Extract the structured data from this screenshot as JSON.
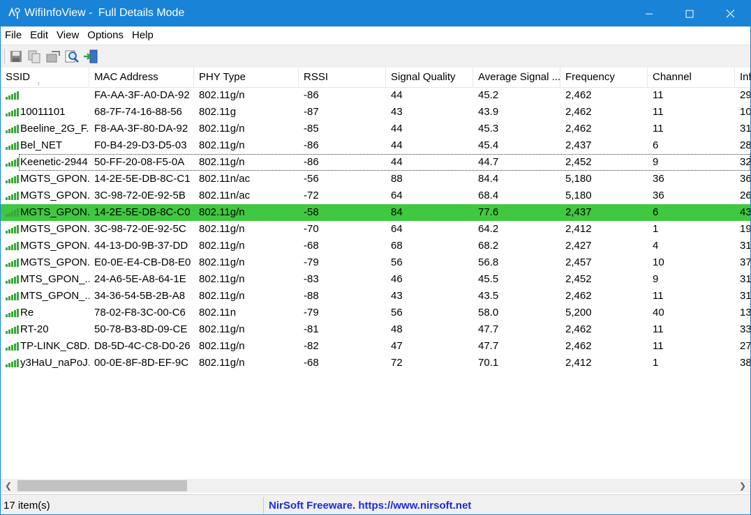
{
  "window": {
    "app_name": "WifiInfoView",
    "mode": "Full Details Mode"
  },
  "menu": [
    "File",
    "Edit",
    "View",
    "Options",
    "Help"
  ],
  "toolbar": {
    "icons": [
      "save-icon",
      "copy-icon",
      "properties-icon",
      "find-icon",
      "exit-icon"
    ]
  },
  "columns": [
    "SSID",
    "MAC Address",
    "PHY Type",
    "RSSI",
    "Signal Quality",
    "Average Signal ...",
    "Frequency",
    "Channel",
    "Inf"
  ],
  "rows": [
    {
      "ssid": "",
      "mac": "FA-AA-3F-A0-DA-92",
      "phy": "802.11g/n",
      "rssi": "-86",
      "quality": "44",
      "avg": "45.2",
      "freq": "2,462",
      "channel": "11",
      "info": "29"
    },
    {
      "ssid": "10011101",
      "mac": "68-7F-74-16-88-56",
      "phy": "802.11g",
      "rssi": "-87",
      "quality": "43",
      "avg": "43.9",
      "freq": "2,462",
      "channel": "11",
      "info": "10"
    },
    {
      "ssid": "Beeline_2G_F...",
      "mac": "F8-AA-3F-80-DA-92",
      "phy": "802.11g/n",
      "rssi": "-85",
      "quality": "44",
      "avg": "45.3",
      "freq": "2,462",
      "channel": "11",
      "info": "31"
    },
    {
      "ssid": "Bel_NET",
      "mac": "F0-B4-29-D3-D5-03",
      "phy": "802.11g/n",
      "rssi": "-86",
      "quality": "44",
      "avg": "45.4",
      "freq": "2,437",
      "channel": "6",
      "info": "28"
    },
    {
      "ssid": "Keenetic-2944",
      "mac": "50-FF-20-08-F5-0A",
      "phy": "802.11g/n",
      "rssi": "-86",
      "quality": "44",
      "avg": "44.7",
      "freq": "2,452",
      "channel": "9",
      "info": "32"
    },
    {
      "ssid": "MGTS_GPON...",
      "mac": "14-2E-5E-DB-8C-C1",
      "phy": "802.11n/ac",
      "rssi": "-56",
      "quality": "88",
      "avg": "84.4",
      "freq": "5,180",
      "channel": "36",
      "info": "36"
    },
    {
      "ssid": "MGTS_GPON...",
      "mac": "3C-98-72-0E-92-5B",
      "phy": "802.11n/ac",
      "rssi": "-72",
      "quality": "64",
      "avg": "68.4",
      "freq": "5,180",
      "channel": "36",
      "info": "26"
    },
    {
      "ssid": "MGTS_GPON...",
      "mac": "14-2E-5E-DB-8C-C0",
      "phy": "802.11g/n",
      "rssi": "-58",
      "quality": "84",
      "avg": "77.6",
      "freq": "2,437",
      "channel": "6",
      "info": "43"
    },
    {
      "ssid": "MGTS_GPON...",
      "mac": "3C-98-72-0E-92-5C",
      "phy": "802.11g/n",
      "rssi": "-70",
      "quality": "64",
      "avg": "64.2",
      "freq": "2,412",
      "channel": "1",
      "info": "19"
    },
    {
      "ssid": "MGTS_GPON...",
      "mac": "44-13-D0-9B-37-DD",
      "phy": "802.11g/n",
      "rssi": "-68",
      "quality": "68",
      "avg": "68.2",
      "freq": "2,427",
      "channel": "4",
      "info": "31"
    },
    {
      "ssid": "MGTS_GPON...",
      "mac": "E0-0E-E4-CB-D8-E0",
      "phy": "802.11g/n",
      "rssi": "-79",
      "quality": "56",
      "avg": "56.8",
      "freq": "2,457",
      "channel": "10",
      "info": "37"
    },
    {
      "ssid": "MTS_GPON_...",
      "mac": "24-A6-5E-A8-64-1E",
      "phy": "802.11g/n",
      "rssi": "-83",
      "quality": "46",
      "avg": "45.5",
      "freq": "2,452",
      "channel": "9",
      "info": "31"
    },
    {
      "ssid": "MTS_GPON_...",
      "mac": "34-36-54-5B-2B-A8",
      "phy": "802.11g/n",
      "rssi": "-88",
      "quality": "43",
      "avg": "43.5",
      "freq": "2,462",
      "channel": "11",
      "info": "31"
    },
    {
      "ssid": "Re",
      "mac": "78-02-F8-3C-00-C6",
      "phy": "802.11n",
      "rssi": "-79",
      "quality": "56",
      "avg": "58.0",
      "freq": "5,200",
      "channel": "40",
      "info": "13"
    },
    {
      "ssid": "RT-20",
      "mac": "50-78-B3-8D-09-CE",
      "phy": "802.11g/n",
      "rssi": "-81",
      "quality": "48",
      "avg": "47.7",
      "freq": "2,462",
      "channel": "11",
      "info": "33"
    },
    {
      "ssid": "TP-LINK_C8D...",
      "mac": "D8-5D-4C-C8-D0-26",
      "phy": "802.11g/n",
      "rssi": "-82",
      "quality": "47",
      "avg": "47.7",
      "freq": "2,462",
      "channel": "11",
      "info": "27"
    },
    {
      "ssid": "y3HaU_naPoJ...",
      "mac": "00-0E-8F-8D-EF-9C",
      "phy": "802.11g/n",
      "rssi": "-68",
      "quality": "72",
      "avg": "70.1",
      "freq": "2,412",
      "channel": "1",
      "info": "38"
    }
  ],
  "selected_row": 7,
  "focused_row": 4,
  "status": {
    "count": "17 item(s)",
    "link": "NirSoft Freeware. https://www.nirsoft.net"
  },
  "colors": {
    "titlebar": "#1883d7",
    "selection": "#40c840",
    "link": "#1b2dd9",
    "signal_bar": "#3aa63a"
  }
}
